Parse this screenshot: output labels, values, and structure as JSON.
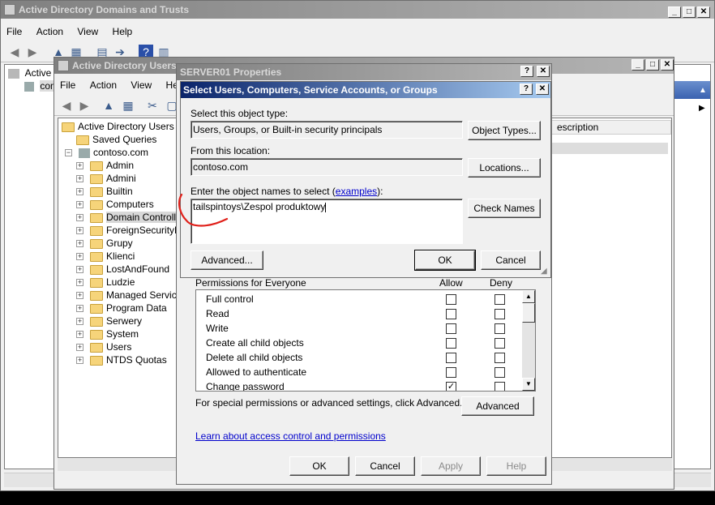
{
  "main_window": {
    "title": "Active Directory Domains and Trusts",
    "menu": [
      "File",
      "Action",
      "View",
      "Help"
    ],
    "tree_root": "Active D",
    "tree_child": "con"
  },
  "aduc_window": {
    "title": "Active Directory Users",
    "menu": [
      "File",
      "Action",
      "View",
      "Help"
    ],
    "tree": {
      "root": "Active Directory Users an",
      "saved_queries": "Saved Queries",
      "domain": "contoso.com",
      "ous": [
        "Admin",
        "Admini",
        "Builtin",
        "Computers",
        "Domain Controller",
        "ForeignSecurityPr",
        "Grupy",
        "Klienci",
        "LostAndFound",
        "Ludzie",
        "Managed Service",
        "Program Data",
        "Serwery",
        "System",
        "Users",
        "NTDS Quotas"
      ]
    },
    "column_header": "escription"
  },
  "properties_dialog": {
    "title": "SERVER01 Properties",
    "permissions_header": "Permissions for Everyone",
    "allow_label": "Allow",
    "deny_label": "Deny",
    "permissions": [
      {
        "name": "Full control",
        "allow": false,
        "deny": false
      },
      {
        "name": "Read",
        "allow": false,
        "deny": false
      },
      {
        "name": "Write",
        "allow": false,
        "deny": false
      },
      {
        "name": "Create all child objects",
        "allow": false,
        "deny": false
      },
      {
        "name": "Delete all child objects",
        "allow": false,
        "deny": false
      },
      {
        "name": "Allowed to authenticate",
        "allow": false,
        "deny": false
      },
      {
        "name": "Change password",
        "allow": true,
        "deny": false
      }
    ],
    "special_text": "For special permissions or advanced settings, click Advanced.",
    "advanced_button": "Advanced",
    "learn_link": "Learn about access control and permissions",
    "ok_button": "OK",
    "cancel_button": "Cancel",
    "apply_button": "Apply",
    "help_button": "Help"
  },
  "select_dialog": {
    "title": "Select Users, Computers, Service Accounts, or Groups",
    "object_type_label": "Select this object type:",
    "object_type_value": "Users, Groups, or Built-in security principals",
    "object_types_button": "Object Types...",
    "location_label": "From this location:",
    "location_value": "contoso.com",
    "locations_button": "Locations...",
    "names_label_prefix": "Enter the object names to select (",
    "names_label_link": "examples",
    "names_label_suffix": "):",
    "names_value": "tailspintoys\\Zespol produktowy",
    "check_names_button": "Check Names",
    "advanced_button": "Advanced...",
    "ok_button": "OK",
    "cancel_button": "Cancel"
  },
  "colors": {
    "annotation": "#e0201a",
    "active_title_start": "#0a246a",
    "active_title_end": "#a6caf0"
  }
}
